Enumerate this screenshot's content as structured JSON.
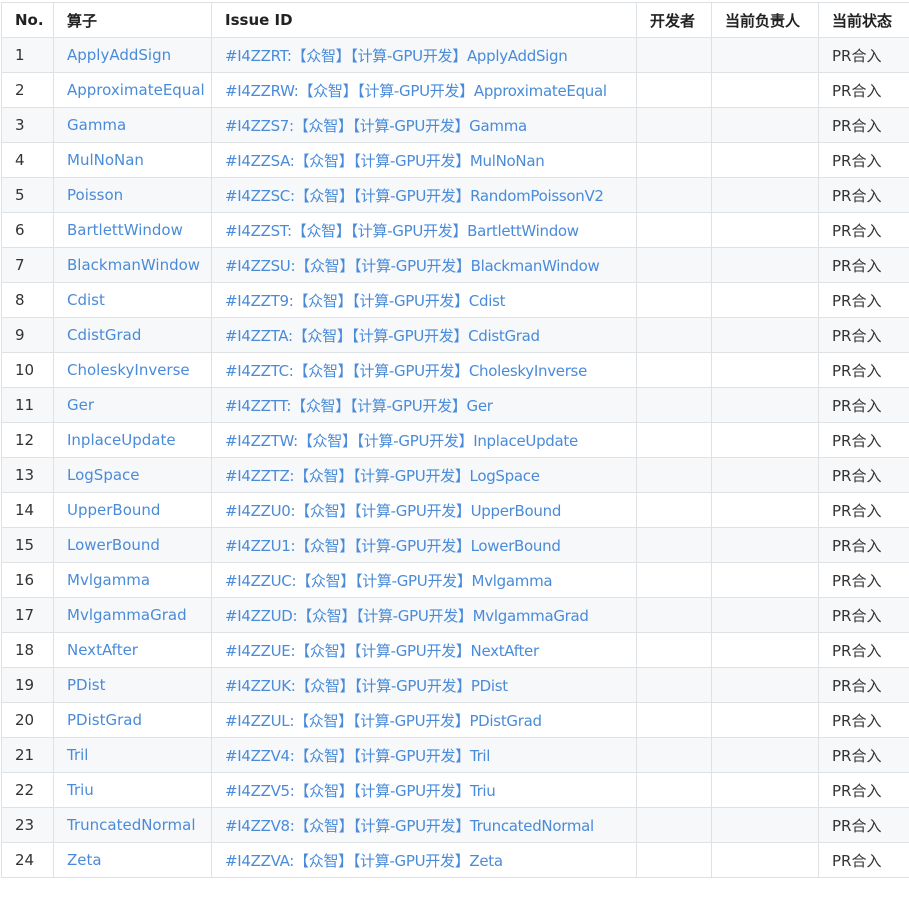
{
  "table": {
    "headers": {
      "no": "No.",
      "op": "算子",
      "issue": "Issue ID",
      "dev": "开发者",
      "owner": "当前负责人",
      "status": "当前状态"
    },
    "rows": [
      {
        "no": "1",
        "op": "ApplyAddSign",
        "issue": "#I4ZZRT:【众智】【计算-GPU开发】ApplyAddSign",
        "dev": "",
        "owner": "",
        "status": "PR合入"
      },
      {
        "no": "2",
        "op": "ApproximateEqual",
        "issue": "#I4ZZRW:【众智】【计算-GPU开发】ApproximateEqual",
        "dev": "",
        "owner": "",
        "status": "PR合入"
      },
      {
        "no": "3",
        "op": "Gamma",
        "issue": "#I4ZZS7:【众智】【计算-GPU开发】Gamma",
        "dev": "",
        "owner": "",
        "status": "PR合入"
      },
      {
        "no": "4",
        "op": "MulNoNan",
        "issue": "#I4ZZSA:【众智】【计算-GPU开发】MulNoNan",
        "dev": "",
        "owner": "",
        "status": "PR合入"
      },
      {
        "no": "5",
        "op": "Poisson",
        "issue": "#I4ZZSC:【众智】【计算-GPU开发】RandomPoissonV2",
        "dev": "",
        "owner": "",
        "status": "PR合入"
      },
      {
        "no": "6",
        "op": "BartlettWindow",
        "issue": "#I4ZZST:【众智】【计算-GPU开发】BartlettWindow",
        "dev": "",
        "owner": "",
        "status": "PR合入"
      },
      {
        "no": "7",
        "op": "BlackmanWindow",
        "issue": "#I4ZZSU:【众智】【计算-GPU开发】BlackmanWindow",
        "dev": "",
        "owner": "",
        "status": "PR合入"
      },
      {
        "no": "8",
        "op": "Cdist",
        "issue": "#I4ZZT9:【众智】【计算-GPU开发】Cdist",
        "dev": "",
        "owner": "",
        "status": "PR合入"
      },
      {
        "no": "9",
        "op": "CdistGrad",
        "issue": "#I4ZZTA:【众智】【计算-GPU开发】CdistGrad",
        "dev": "",
        "owner": "",
        "status": "PR合入"
      },
      {
        "no": "10",
        "op": "CholeskyInverse",
        "issue": "#I4ZZTC:【众智】【计算-GPU开发】CholeskyInverse",
        "dev": "",
        "owner": "",
        "status": "PR合入"
      },
      {
        "no": "11",
        "op": "Ger",
        "issue": "#I4ZZTT:【众智】【计算-GPU开发】Ger",
        "dev": "",
        "owner": "",
        "status": "PR合入"
      },
      {
        "no": "12",
        "op": "InplaceUpdate",
        "issue": "#I4ZZTW:【众智】【计算-GPU开发】InplaceUpdate",
        "dev": "",
        "owner": "",
        "status": "PR合入"
      },
      {
        "no": "13",
        "op": "LogSpace",
        "issue": "#I4ZZTZ:【众智】【计算-GPU开发】LogSpace",
        "dev": "",
        "owner": "",
        "status": "PR合入"
      },
      {
        "no": "14",
        "op": "UpperBound",
        "issue": "#I4ZZU0:【众智】【计算-GPU开发】UpperBound",
        "dev": "",
        "owner": "",
        "status": "PR合入"
      },
      {
        "no": "15",
        "op": "LowerBound",
        "issue": "#I4ZZU1:【众智】【计算-GPU开发】LowerBound",
        "dev": "",
        "owner": "",
        "status": "PR合入"
      },
      {
        "no": "16",
        "op": "Mvlgamma",
        "issue": "#I4ZZUC:【众智】【计算-GPU开发】Mvlgamma",
        "dev": "",
        "owner": "",
        "status": "PR合入"
      },
      {
        "no": "17",
        "op": "MvlgammaGrad",
        "issue": "#I4ZZUD:【众智】【计算-GPU开发】MvlgammaGrad",
        "dev": "",
        "owner": "",
        "status": "PR合入"
      },
      {
        "no": "18",
        "op": "NextAfter",
        "issue": "#I4ZZUE:【众智】【计算-GPU开发】NextAfter",
        "dev": "",
        "owner": "",
        "status": "PR合入"
      },
      {
        "no": "19",
        "op": "PDist",
        "issue": "#I4ZZUK:【众智】【计算-GPU开发】PDist",
        "dev": "",
        "owner": "",
        "status": "PR合入"
      },
      {
        "no": "20",
        "op": "PDistGrad",
        "issue": "#I4ZZUL:【众智】【计算-GPU开发】PDistGrad",
        "dev": "",
        "owner": "",
        "status": "PR合入"
      },
      {
        "no": "21",
        "op": "Tril",
        "issue": "#I4ZZV4:【众智】【计算-GPU开发】Tril",
        "dev": "",
        "owner": "",
        "status": "PR合入"
      },
      {
        "no": "22",
        "op": "Triu",
        "issue": "#I4ZZV5:【众智】【计算-GPU开发】Triu",
        "dev": "",
        "owner": "",
        "status": "PR合入"
      },
      {
        "no": "23",
        "op": "TruncatedNormal",
        "issue": "#I4ZZV8:【众智】【计算-GPU开发】TruncatedNormal",
        "dev": "",
        "owner": "",
        "status": "PR合入"
      },
      {
        "no": "24",
        "op": "Zeta",
        "issue": "#I4ZZVA:【众智】【计算-GPU开发】Zeta",
        "dev": "",
        "owner": "",
        "status": "PR合入"
      }
    ]
  },
  "colors": {
    "link": "#4a8bd9",
    "border": "#dfe2e5",
    "stripe": "#f6f8fa",
    "text": "#333333"
  }
}
